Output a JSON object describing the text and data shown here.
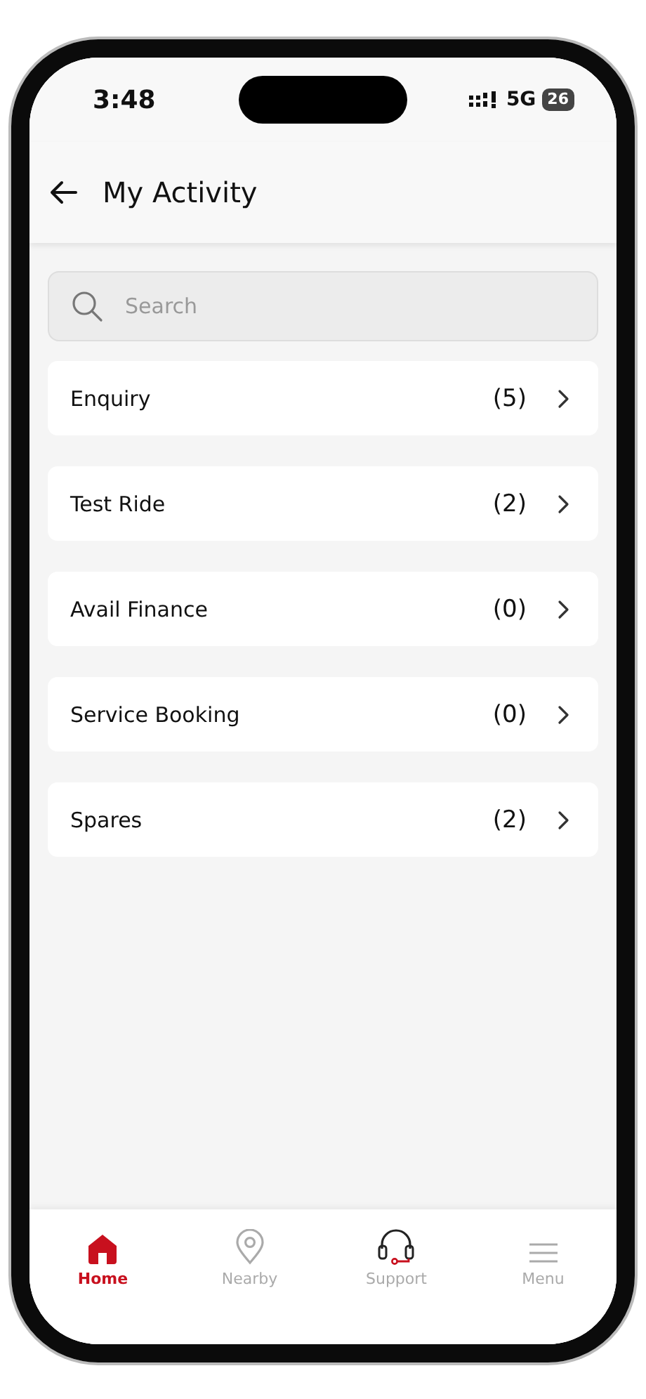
{
  "status_bar": {
    "time": "3:48",
    "network": "5G",
    "battery": "26"
  },
  "header": {
    "title": "My Activity"
  },
  "search": {
    "placeholder": "Search"
  },
  "items": [
    {
      "label": "Enquiry",
      "count": "(5)"
    },
    {
      "label": "Test Ride",
      "count": "(2)"
    },
    {
      "label": "Avail Finance",
      "count": "(0)"
    },
    {
      "label": "Service Booking",
      "count": "(0)"
    },
    {
      "label": "Spares",
      "count": "(2)"
    }
  ],
  "nav": [
    {
      "kind": "home",
      "label": "Home",
      "selected": true
    },
    {
      "kind": "pin",
      "label": "Nearby",
      "selected": false
    },
    {
      "kind": "headset",
      "label": "Support",
      "selected": false
    },
    {
      "kind": "menu",
      "label": "Menu",
      "selected": false
    }
  ]
}
